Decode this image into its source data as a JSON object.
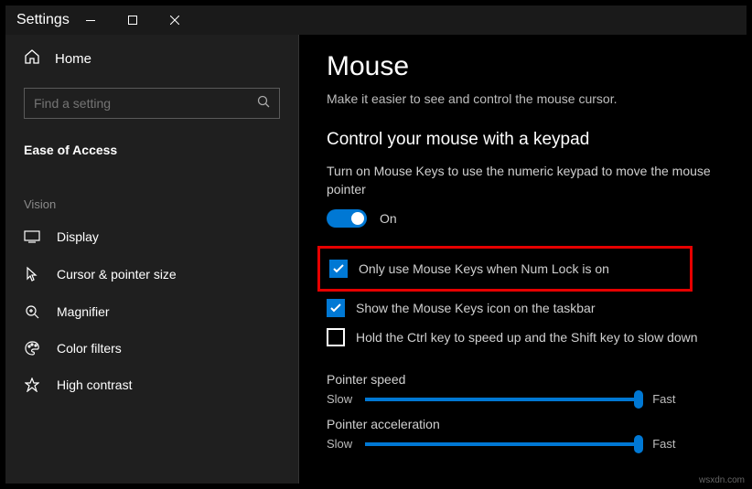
{
  "window": {
    "title": "Settings"
  },
  "sidebar": {
    "home": "Home",
    "search_placeholder": "Find a setting",
    "category": "Ease of Access",
    "group": "Vision",
    "items": [
      {
        "label": "Display"
      },
      {
        "label": "Cursor & pointer size"
      },
      {
        "label": "Magnifier"
      },
      {
        "label": "Color filters"
      },
      {
        "label": "High contrast"
      }
    ]
  },
  "main": {
    "title": "Mouse",
    "subtitle": "Make it easier to see and control the mouse cursor.",
    "section": "Control your mouse with a keypad",
    "desc": "Turn on Mouse Keys to use the numeric keypad to move the mouse pointer",
    "toggle": {
      "state": "On"
    },
    "checks": [
      {
        "label": "Only use Mouse Keys when Num Lock is on",
        "checked": true,
        "highlight": true
      },
      {
        "label": "Show the Mouse Keys icon on the taskbar",
        "checked": true
      },
      {
        "label": "Hold the Ctrl key to speed up and the Shift key to slow down",
        "checked": false
      }
    ],
    "sliders": [
      {
        "label": "Pointer speed",
        "min": "Slow",
        "max": "Fast"
      },
      {
        "label": "Pointer acceleration",
        "min": "Slow",
        "max": "Fast"
      }
    ]
  },
  "watermark": "wsxdn.com"
}
